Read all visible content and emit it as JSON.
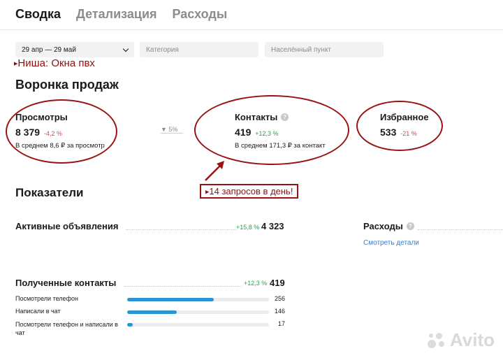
{
  "tabs": [
    {
      "label": "Сводка",
      "active": true
    },
    {
      "label": "Детализация",
      "active": false
    },
    {
      "label": "Расходы",
      "active": false
    }
  ],
  "filters": {
    "date_value": "29 апр — 29 май",
    "category_placeholder": "Категория",
    "city_placeholder": "Населённый пункт"
  },
  "annotation_niche": "Ниша: Окна пвх",
  "funnel": {
    "title": "Воронка продаж",
    "views": {
      "label": "Просмотры",
      "value": "8 379",
      "delta": "-4,2 %",
      "note": "В среднем 8,6 ₽ за просмотр"
    },
    "conversion": "5%",
    "contacts": {
      "label": "Контакты",
      "value": "419",
      "delta": "+12,3 %",
      "note": "В среднем 171,3 ₽ за контакт"
    },
    "favorites": {
      "label": "Избранное",
      "value": "533",
      "delta": "-21 %"
    }
  },
  "annotation_callout": "14 запросов в день!",
  "indicators": {
    "title": "Показатели",
    "active_ads": {
      "label": "Активные объявления",
      "delta": "+15,8 %",
      "value": "4 323"
    },
    "expenses": {
      "label": "Расходы",
      "link": "Смотреть детали"
    },
    "received_contacts": {
      "label": "Полученные контакты",
      "delta": "+12,3 %",
      "value": "419"
    },
    "breakdown": [
      {
        "label": "Посмотрели телефон",
        "value": "256",
        "share": 0.61
      },
      {
        "label": "Написали в чат",
        "value": "146",
        "share": 0.35
      },
      {
        "label": "Посмотрели телефон и написали в чат",
        "value": "17",
        "share": 0.04
      }
    ]
  },
  "watermark": "Avito",
  "colors": {
    "annotation_red": "#9a1212",
    "bar_blue": "#2b95d4",
    "positive": "#2e9e55",
    "negative": "#d14b4b",
    "link": "#2e7dd4"
  }
}
